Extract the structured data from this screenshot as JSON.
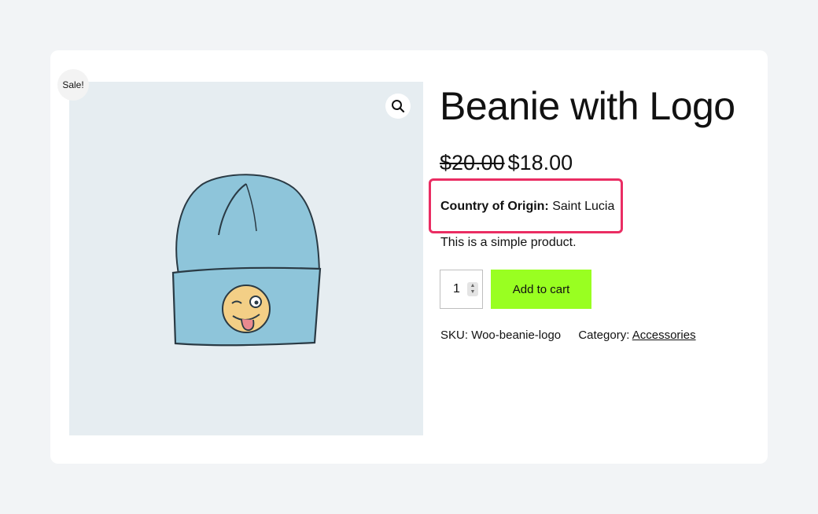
{
  "badge": {
    "sale": "Sale!"
  },
  "icons": {
    "zoom": "magnifier-icon",
    "product_image": "beanie-with-logo-illustration"
  },
  "product": {
    "title": "Beanie with Logo",
    "price_regular": "$20.00",
    "price_sale": "$18.00",
    "origin_label": "Country of Origin:",
    "origin_value": "Saint Lucia",
    "description": "This is a simple product.",
    "quantity": "1",
    "add_to_cart": "Add to cart",
    "sku_label": "SKU:",
    "sku_value": "Woo-beanie-logo",
    "category_label": "Category:",
    "category_value": "Accessories"
  },
  "colors": {
    "page_bg": "#f2f4f6",
    "image_bg": "#e6edf1",
    "highlight_border": "#ea2d63",
    "button_bg": "#99ff21"
  }
}
